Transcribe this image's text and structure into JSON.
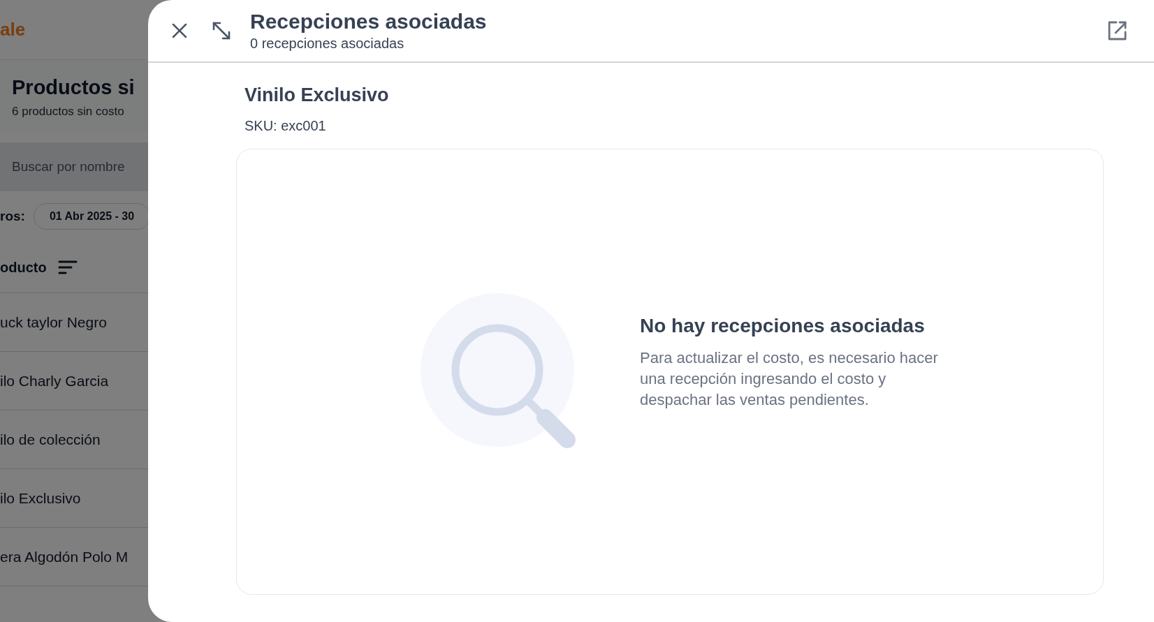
{
  "background_page": {
    "logo": "ale",
    "title": "Productos si",
    "subtitle": "6 productos sin costo",
    "search": {
      "placeholder": "Buscar por nombre"
    },
    "filters_label": "ros:",
    "date_chip": "01 Abr 2025 - 30",
    "column_header": "oducto",
    "rows": [
      "uck taylor Negro",
      "ilo Charly Garcia",
      "ilo de colección",
      "ilo Exclusivo",
      "era Algodón Polo M"
    ]
  },
  "drawer": {
    "title": "Recepciones asociadas",
    "subtitle": "0 recepciones asociadas",
    "product": {
      "name": "Vinilo Exclusivo",
      "sku": "SKU: exc001"
    },
    "empty_state": {
      "title": "No hay recepciones asociadas",
      "message": "Para actualizar el costo, es necesario hacer una recepción ingresando el costo y despachar las ventas pendientes."
    }
  }
}
